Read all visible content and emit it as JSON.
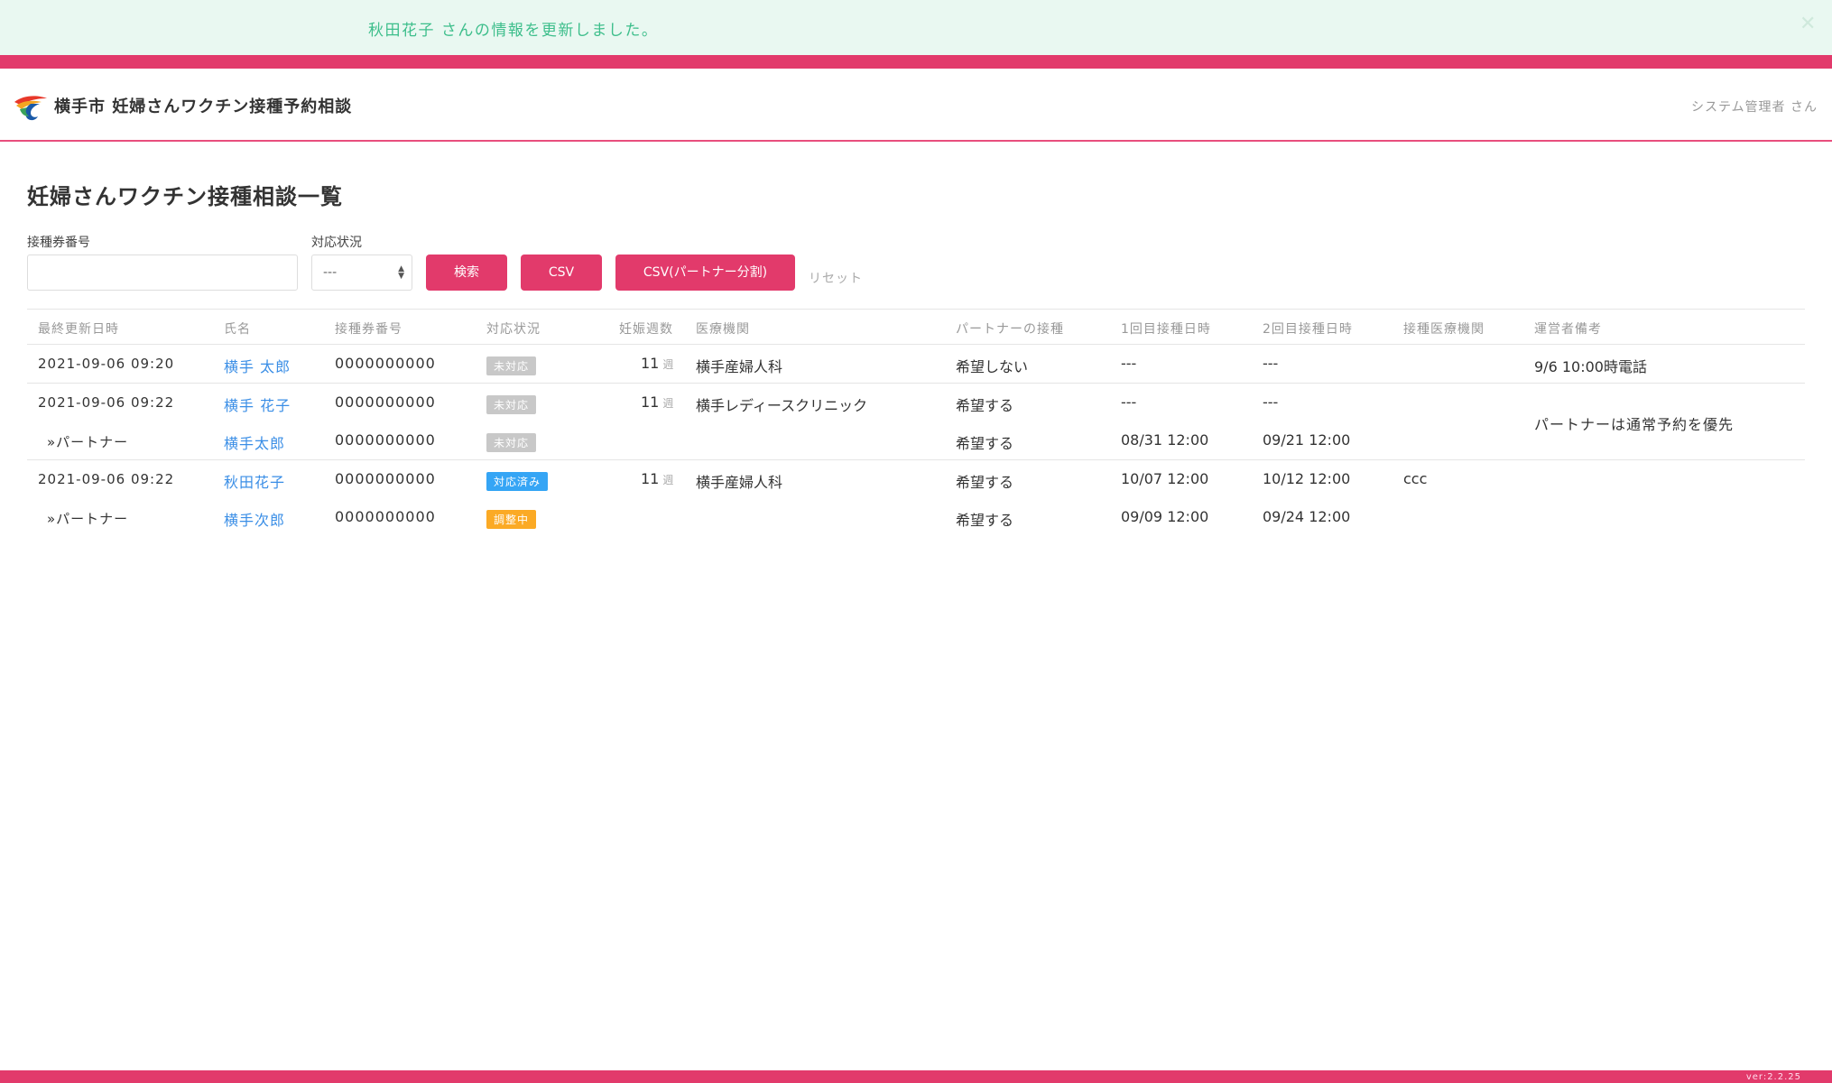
{
  "flash": {
    "message": "秋田花子 さんの情報を更新しました。",
    "close_icon": "close-icon"
  },
  "header": {
    "title": "横手市 妊婦さんワクチン接種予約相談",
    "user": "システム管理者 さん",
    "logo_icon": "city-logo-icon"
  },
  "page": {
    "title": "妊婦さんワクチン接種相談一覧"
  },
  "filters": {
    "ticket_label": "接種券番号",
    "ticket_value": "",
    "status_label": "対応状況",
    "status_selected": "---",
    "search_button": "検索",
    "csv_button": "CSV",
    "csv_partner_button": "CSV(パートナー分割)",
    "reset_link": "リセット"
  },
  "table": {
    "headers": [
      "最終更新日時",
      "氏名",
      "接種券番号",
      "対応状況",
      "妊娠週数",
      "医療機関",
      "パートナーの接種",
      "1回目接種日時",
      "2回目接種日時",
      "接種医療機関",
      "運営者備考"
    ],
    "week_unit": "週",
    "groups": [
      {
        "note": "9/6 10:00時電話",
        "rows": [
          {
            "updated": "2021-09-06 09:20",
            "name": "横手 太郎",
            "ticket": "0000000000",
            "status": "未対応",
            "weeks": "11",
            "hospital": "横手産婦人科",
            "partner": "希望しない",
            "first": "---",
            "second": "---",
            "vaccine_hospital": ""
          }
        ]
      },
      {
        "note": "パートナーは通常予約を優先",
        "rows": [
          {
            "updated": "2021-09-06 09:22",
            "name": "横手 花子",
            "ticket": "0000000000",
            "status": "未対応",
            "weeks": "11",
            "hospital": "横手レディースクリニック",
            "partner": "希望する",
            "first": "---",
            "second": "---",
            "vaccine_hospital": ""
          },
          {
            "updated": "»パートナー",
            "name": "横手太郎",
            "ticket": "0000000000",
            "status": "未対応",
            "weeks": "",
            "hospital": "",
            "partner": "希望する",
            "first": "08/31 12:00",
            "second": "09/21 12:00",
            "vaccine_hospital": ""
          }
        ]
      },
      {
        "note": "",
        "rows": [
          {
            "updated": "2021-09-06 09:22",
            "name": "秋田花子",
            "ticket": "0000000000",
            "status": "対応済み",
            "weeks": "11",
            "hospital": "横手産婦人科",
            "partner": "希望する",
            "first": "10/07 12:00",
            "second": "10/12 12:00",
            "vaccine_hospital": "ccc"
          },
          {
            "updated": "»パートナー",
            "name": "横手次郎",
            "ticket": "0000000000",
            "status": "調整中",
            "weeks": "",
            "hospital": "",
            "partner": "希望する",
            "first": "09/09 12:00",
            "second": "09/24 12:00",
            "vaccine_hospital": ""
          }
        ]
      }
    ]
  },
  "colors": {
    "brand": "#e23a6b",
    "link": "#3a8ee6",
    "status_none": "#c8c8c8",
    "status_done": "#35a5f5",
    "status_adjusting": "#fbaa25",
    "flash_bg": "#e9f8f1",
    "flash_text": "#3dbe8b"
  },
  "footer": {
    "version": "ver:2.2.25"
  }
}
